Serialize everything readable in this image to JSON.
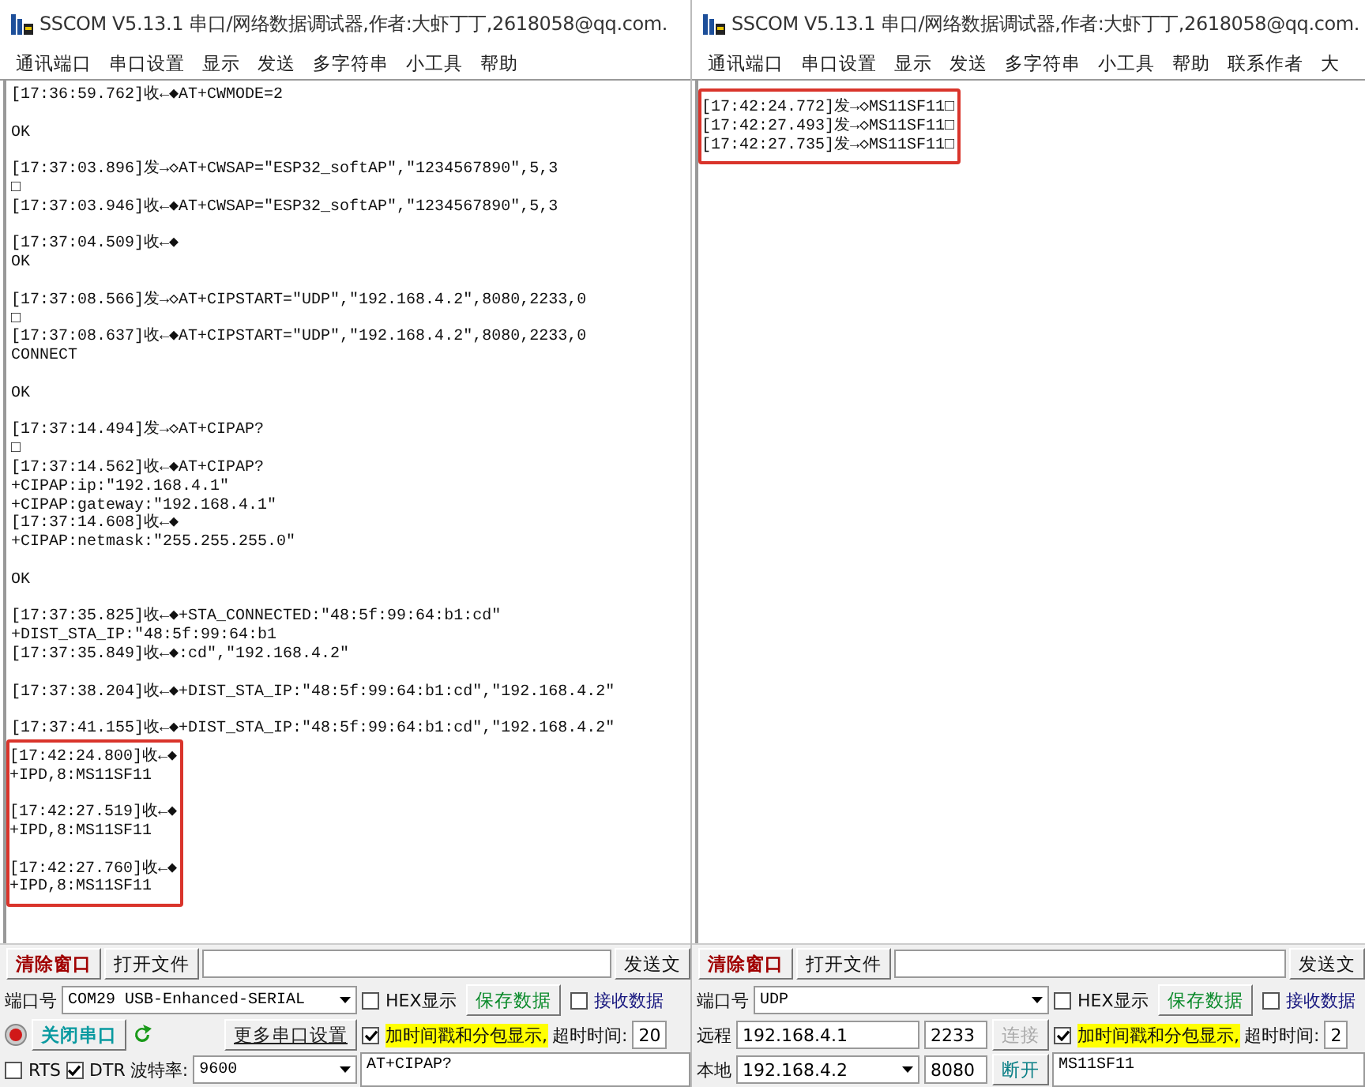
{
  "windows": [
    {
      "title": "SSCOM V5.13.1 串口/网络数据调试器,作者:大虾丁丁,2618058@qq.com.",
      "menu": [
        "通讯端口",
        "串口设置",
        "显示",
        "发送",
        "多字符串",
        "小工具",
        "帮助"
      ],
      "log": {
        "sections": [
          {
            "highlighted": false,
            "blocks": [
              [
                "[17:36:59.762]收←◆AT+CWMODE=2"
              ],
              [
                "OK"
              ],
              [
                "[17:37:03.896]发→◇AT+CWSAP=\"ESP32_softAP\",\"1234567890\",5,3",
                "□",
                "[17:37:03.946]收←◆AT+CWSAP=\"ESP32_softAP\",\"1234567890\",5,3"
              ],
              [
                "[17:37:04.509]收←◆",
                "OK"
              ],
              [
                "[17:37:08.566]发→◇AT+CIPSTART=\"UDP\",\"192.168.4.2\",8080,2233,0",
                "□",
                "[17:37:08.637]收←◆AT+CIPSTART=\"UDP\",\"192.168.4.2\",8080,2233,0",
                "CONNECT"
              ],
              [
                "OK"
              ],
              [
                "[17:37:14.494]发→◇AT+CIPAP?",
                "□",
                "[17:37:14.562]收←◆AT+CIPAP?",
                "+CIPAP:ip:\"192.168.4.1\"",
                "+CIPAP:gateway:\"192.168.4.1\"",
                "[17:37:14.608]收←◆",
                "+CIPAP:netmask:\"255.255.255.0\""
              ],
              [
                "OK"
              ],
              [
                "[17:37:35.825]收←◆+STA_CONNECTED:\"48:5f:99:64:b1:cd\"",
                "+DIST_STA_IP:\"48:5f:99:64:b1",
                "[17:37:35.849]收←◆:cd\",\"192.168.4.2\""
              ],
              [
                "[17:37:38.204]收←◆+DIST_STA_IP:\"48:5f:99:64:b1:cd\",\"192.168.4.2\""
              ],
              [
                "[17:37:41.155]收←◆+DIST_STA_IP:\"48:5f:99:64:b1:cd\",\"192.168.4.2\""
              ]
            ]
          },
          {
            "highlighted": true,
            "blocks": [
              [
                "[17:42:24.800]收←◆",
                "+IPD,8:MS11SF11"
              ],
              [
                "[17:42:27.519]收←◆",
                "+IPD,8:MS11SF11"
              ],
              [
                "[17:42:27.760]收←◆",
                "+IPD,8:MS11SF11"
              ]
            ]
          }
        ]
      },
      "toolbar": {
        "clear_button": "清除窗口",
        "open_file_button": "打开文件",
        "send_file_button": "发送文"
      },
      "port_panel": {
        "kind": "serial",
        "port_label": "端口号",
        "port_value": "COM29 USB-Enhanced-SERIAL",
        "close_button": "关闭串口",
        "more_settings_button": "更多串口设置",
        "rts": {
          "label": "RTS",
          "checked": false
        },
        "dtr": {
          "label": "DTR",
          "checked": true
        },
        "baud_label": "波特率:",
        "baud_value": "9600"
      },
      "options": {
        "hex": {
          "label": "HEX显示",
          "checked": false
        },
        "save_button": "保存数据",
        "receive": {
          "label": "接收数据",
          "checked": false
        },
        "timestamp": {
          "label": "加时间戳和分包显示,",
          "checked": true
        },
        "timeout_label": "超时时间:",
        "timeout_value": "20"
      },
      "send_text": "AT+CIPAP?"
    },
    {
      "title": "SSCOM V5.13.1 串口/网络数据调试器,作者:大虾丁丁,2618058@qq.com.",
      "menu": [
        "通讯端口",
        "串口设置",
        "显示",
        "发送",
        "多字符串",
        "小工具",
        "帮助",
        "联系作者",
        "大"
      ],
      "log": {
        "sections": [
          {
            "highlighted": true,
            "blocks": [
              [
                "[17:42:24.772]发→◇MS11SF11□",
                "[17:42:27.493]发→◇MS11SF11□",
                "[17:42:27.735]发→◇MS11SF11□"
              ]
            ]
          }
        ]
      },
      "toolbar": {
        "clear_button": "清除窗口",
        "open_file_button": "打开文件",
        "send_file_button": "发送文"
      },
      "port_panel": {
        "kind": "network",
        "port_label": "端口号",
        "port_value": "UDP",
        "remote_label": "远程",
        "remote_ip": "192.168.4.1",
        "remote_port": "2233",
        "connect_button": {
          "label": "连接",
          "disabled": true
        },
        "local_label": "本地",
        "local_ip": "192.168.4.2",
        "local_port": "8080",
        "disconnect_button": {
          "label": "断开",
          "disabled": false
        }
      },
      "options": {
        "hex": {
          "label": "HEX显示",
          "checked": false
        },
        "save_button": "保存数据",
        "receive": {
          "label": "接收数据",
          "checked": false
        },
        "timestamp": {
          "label": "加时间戳和分包显示,",
          "checked": true
        },
        "timeout_label": "超时时间:",
        "timeout_value": "2"
      },
      "send_text": "MS11SF11"
    }
  ]
}
